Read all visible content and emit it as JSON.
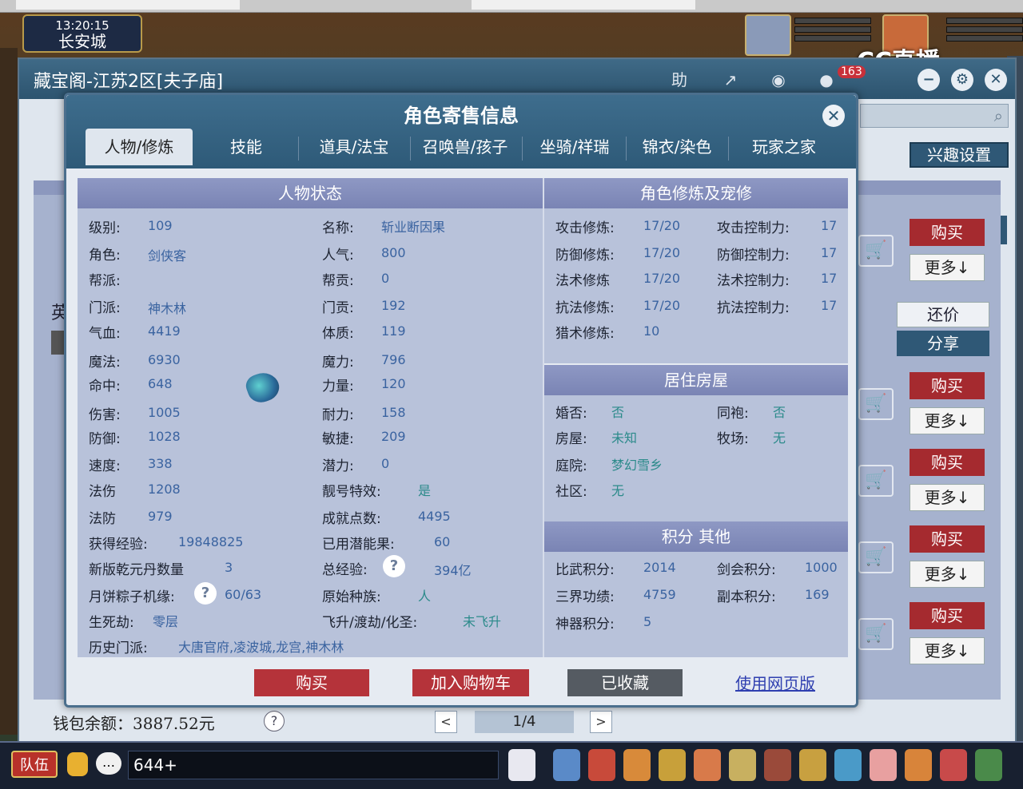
{
  "hud": {
    "time": "13:20:15",
    "location": "长安城",
    "stream_logo": "CC直播"
  },
  "shop": {
    "title": "藏宝阁-江苏2区[夫子庙]",
    "assist_label": "助",
    "badge_count": "163",
    "interest_button": "兴趣设置",
    "side_glyph": "英",
    "buy_label": "购买",
    "more_label": "更多↓",
    "bargain_label": "还价",
    "share_label": "分享",
    "wallet": "钱包余额：3887.52元",
    "wallet_help": "?",
    "page": "1/4",
    "prev": "<",
    "next": ">"
  },
  "modal": {
    "title": "角色寄售信息",
    "close": "✕",
    "tabs": [
      "人物/修炼",
      "技能",
      "道具/法宝",
      "召唤兽/孩子",
      "坐骑/祥瑞",
      "锦衣/染色",
      "玩家之家"
    ],
    "status": {
      "header": "人物状态",
      "level_k": "级别:",
      "level_v": "109",
      "role_k": "角色:",
      "role_v": "剑侠客",
      "gang_k": "帮派:",
      "gang_v": "",
      "school_k": "门派:",
      "school_v": "神木林",
      "hp_k": "气血:",
      "hp_v": "4419",
      "mp_k": "魔法:",
      "mp_v": "6930",
      "hit_k": "命中:",
      "hit_v": "648",
      "dmg_k": "伤害:",
      "dmg_v": "1005",
      "def_k": "防御:",
      "def_v": "1028",
      "spd_k": "速度:",
      "spd_v": "338",
      "mdmg_k": "法伤",
      "mdmg_v": "1208",
      "mdef_k": "法防",
      "mdef_v": "979",
      "exp_k": "获得经验:",
      "exp_v": "19848825",
      "qy_k": "新版乾元丹数量",
      "qy_v": "3",
      "moon_k": "月饼粽子机缘:",
      "moon_v": "60/63",
      "life_k": "生死劫:",
      "life_v": "零层",
      "hist_k": "历史门派:",
      "hist_v": "大唐官府,凌波城,龙宫,神木林",
      "name_k": "名称:",
      "name_v": "斩业断因果",
      "pop_k": "人气:",
      "pop_v": "800",
      "gcon_k": "帮贡:",
      "gcon_v": "0",
      "scon_k": "门贡:",
      "scon_v": "192",
      "con_k": "体质:",
      "con_v": "119",
      "mag_k": "魔力:",
      "mag_v": "796",
      "str_k": "力量:",
      "str_v": "120",
      "end_k": "耐力:",
      "end_v": "158",
      "agi_k": "敏捷:",
      "agi_v": "209",
      "pot_k": "潜力:",
      "pot_v": "0",
      "lucky_k": "靓号特效:",
      "lucky_v": "是",
      "ach_k": "成就点数:",
      "ach_v": "4495",
      "fruit_k": "已用潜能果:",
      "fruit_v": "60",
      "texp_k": "总经验:",
      "texp_v": "394亿",
      "race_k": "原始种族:",
      "race_v": "人",
      "fly_k": "飞升/渡劫/化圣:",
      "fly_v": "未飞升",
      "help": "?"
    },
    "cultivation": {
      "header": "角色修炼及宠修",
      "atk_k": "攻击修炼:",
      "atk_v": "17/20",
      "df_k": "防御修炼:",
      "df_v": "17/20",
      "sp_k": "法术修炼",
      "sp_v": "17/20",
      "rs_k": "抗法修炼:",
      "rs_v": "17/20",
      "hunt_k": "猎术修炼:",
      "hunt_v": "10",
      "catk_k": "攻击控制力:",
      "catk_v": "17",
      "cdf_k": "防御控制力:",
      "cdf_v": "17",
      "csp_k": "法术控制力:",
      "csp_v": "17",
      "crs_k": "抗法控制力:",
      "crs_v": "17"
    },
    "house": {
      "header": "居住房屋",
      "married_k": "婚否:",
      "married_v": "否",
      "sworn_k": "同袍:",
      "sworn_v": "否",
      "house_k": "房屋:",
      "house_v": "未知",
      "ranch_k": "牧场:",
      "ranch_v": "无",
      "yard_k": "庭院:",
      "yard_v": "梦幻雪乡",
      "comm_k": "社区:",
      "comm_v": "无"
    },
    "points": {
      "header": "积分 其他",
      "pvp_k": "比武积分:",
      "pvp_v": "2014",
      "sword_k": "剑会积分:",
      "sword_v": "1000",
      "merit_k": "三界功绩:",
      "merit_v": "4759",
      "dungeon_k": "副本积分:",
      "dungeon_v": "169",
      "art_k": "神器积分:",
      "art_v": "5"
    },
    "buttons": {
      "buy": "购买",
      "cart": "加入购物车",
      "fav": "已收藏",
      "web": "使用网页版"
    }
  },
  "bottom": {
    "team": "队伍",
    "chat_value": "644+"
  }
}
